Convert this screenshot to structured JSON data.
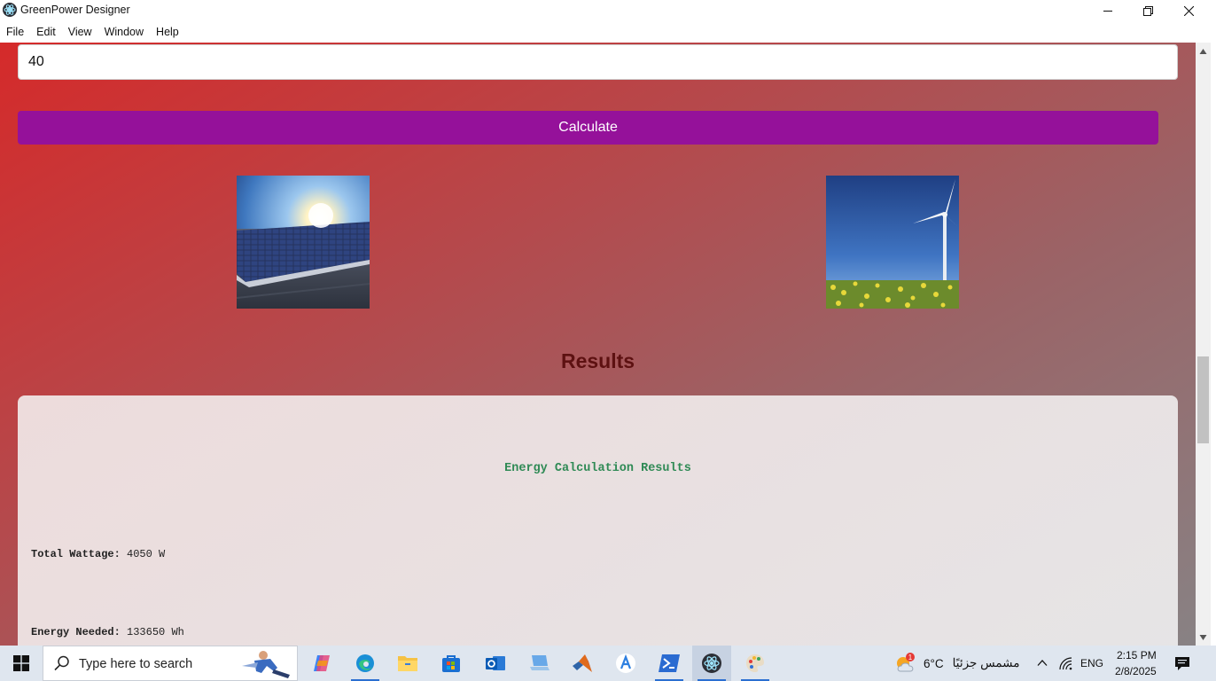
{
  "window": {
    "title": "GreenPower Designer",
    "menu": [
      "File",
      "Edit",
      "View",
      "Window",
      "Help"
    ]
  },
  "form": {
    "input_value": "40",
    "calculate_label": "Calculate"
  },
  "images": [
    {
      "subject": "solar-panels-photo"
    },
    {
      "subject": "wind-turbine-photo"
    }
  ],
  "results": {
    "heading": "Results",
    "panel_title": "Energy Calculation Results",
    "lines": [
      {
        "label": "Total Wattage:",
        "value": "4050 W"
      },
      {
        "label": "Energy Needed:",
        "value": "133650 Wh"
      }
    ]
  },
  "taskbar": {
    "search_placeholder": "Type here to search",
    "weather_temp": "6°C",
    "weather_condition": "مشمس جزئيًا",
    "weather_badge": "1",
    "language": "ENG",
    "time": "2:15 PM",
    "date": "2/8/2025"
  },
  "colors": {
    "calculate_button": "#95119a",
    "results_heading": "#5d1111",
    "results_title": "#2f8a55"
  }
}
